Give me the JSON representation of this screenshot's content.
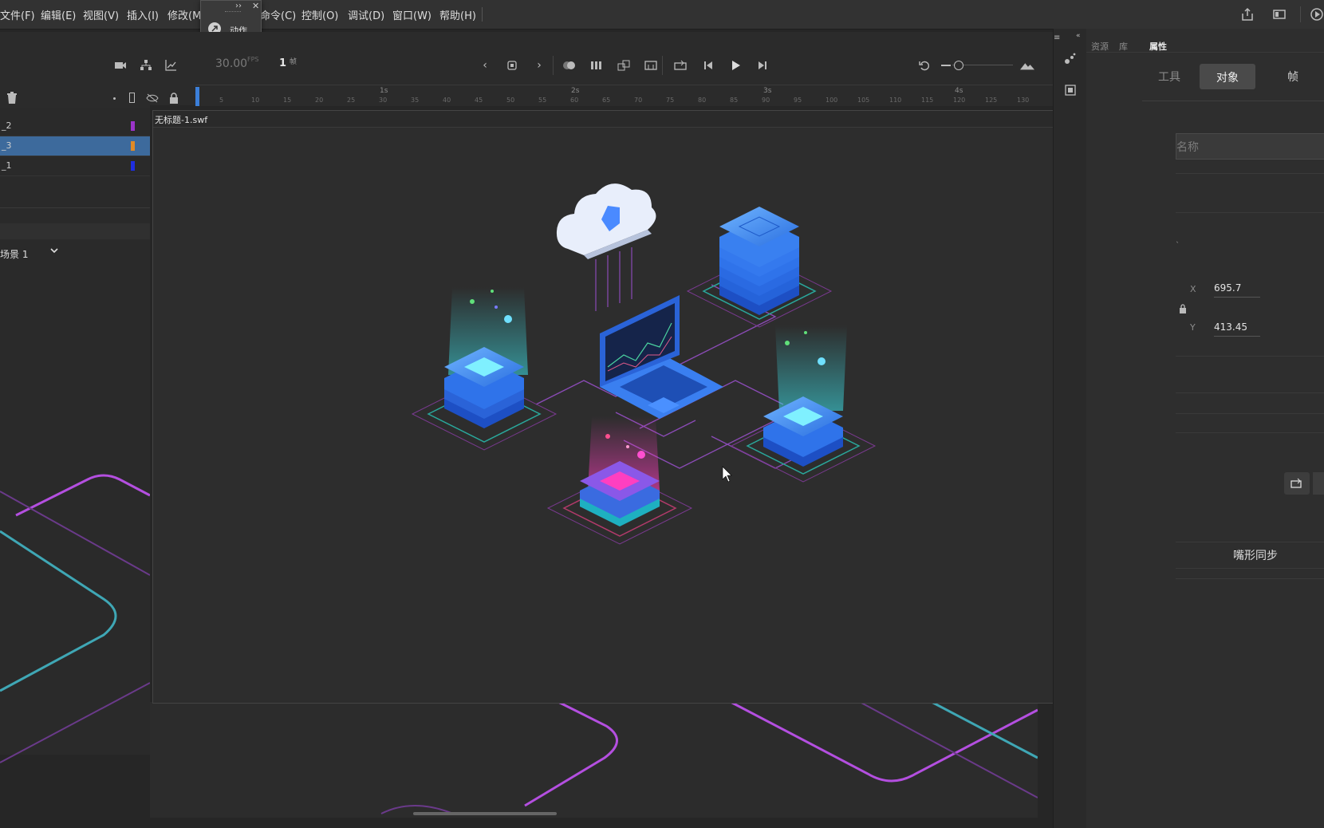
{
  "menu": {
    "items": [
      "文件(F)",
      "编辑(E)",
      "视图(V)",
      "插入(I)",
      "修改(M",
      "命令(C)",
      "控制(O)",
      "调试(D)",
      "窗口(W)",
      "帮助(H)"
    ]
  },
  "action_popup": {
    "label": "动作"
  },
  "timeline": {
    "fps_value": "30.00",
    "fps_unit": "FPS",
    "frame_value": "1",
    "frame_unit": "帧",
    "second_marks": [
      "1s",
      "2s",
      "3s",
      "4s"
    ],
    "frame_ticks": [
      "5",
      "10",
      "15",
      "20",
      "25",
      "30",
      "35",
      "40",
      "45",
      "50",
      "55",
      "60",
      "65",
      "70",
      "75",
      "80",
      "85",
      "90",
      "95",
      "100",
      "105",
      "110",
      "115",
      "120",
      "125",
      "130"
    ]
  },
  "layers": [
    {
      "name": "_2",
      "color": "#9b34c9",
      "selected": false
    },
    {
      "name": "_3",
      "color": "#e08a26",
      "selected": true
    },
    {
      "name": "_1",
      "color": "#1e2ee0",
      "selected": false
    }
  ],
  "scene": {
    "label": "场景 1"
  },
  "swf_window": {
    "title": "无标题-1.swf"
  },
  "panel": {
    "tabs": [
      "资源",
      "库",
      "属性"
    ],
    "subtabs": [
      "工具",
      "对象",
      "帧"
    ],
    "active_subtab": "对象",
    "name_placeholder": "名称",
    "x_label": "X",
    "x_value": "695.7",
    "y_label": "Y",
    "y_value": "413.45",
    "lip_sync_label": "嘴形同步"
  },
  "colors": {
    "accent": "#3a6ea5",
    "layer_selected": "#3d6a9c",
    "neon_purple": "#b44fe0",
    "neon_teal": "#3fa7b5"
  }
}
